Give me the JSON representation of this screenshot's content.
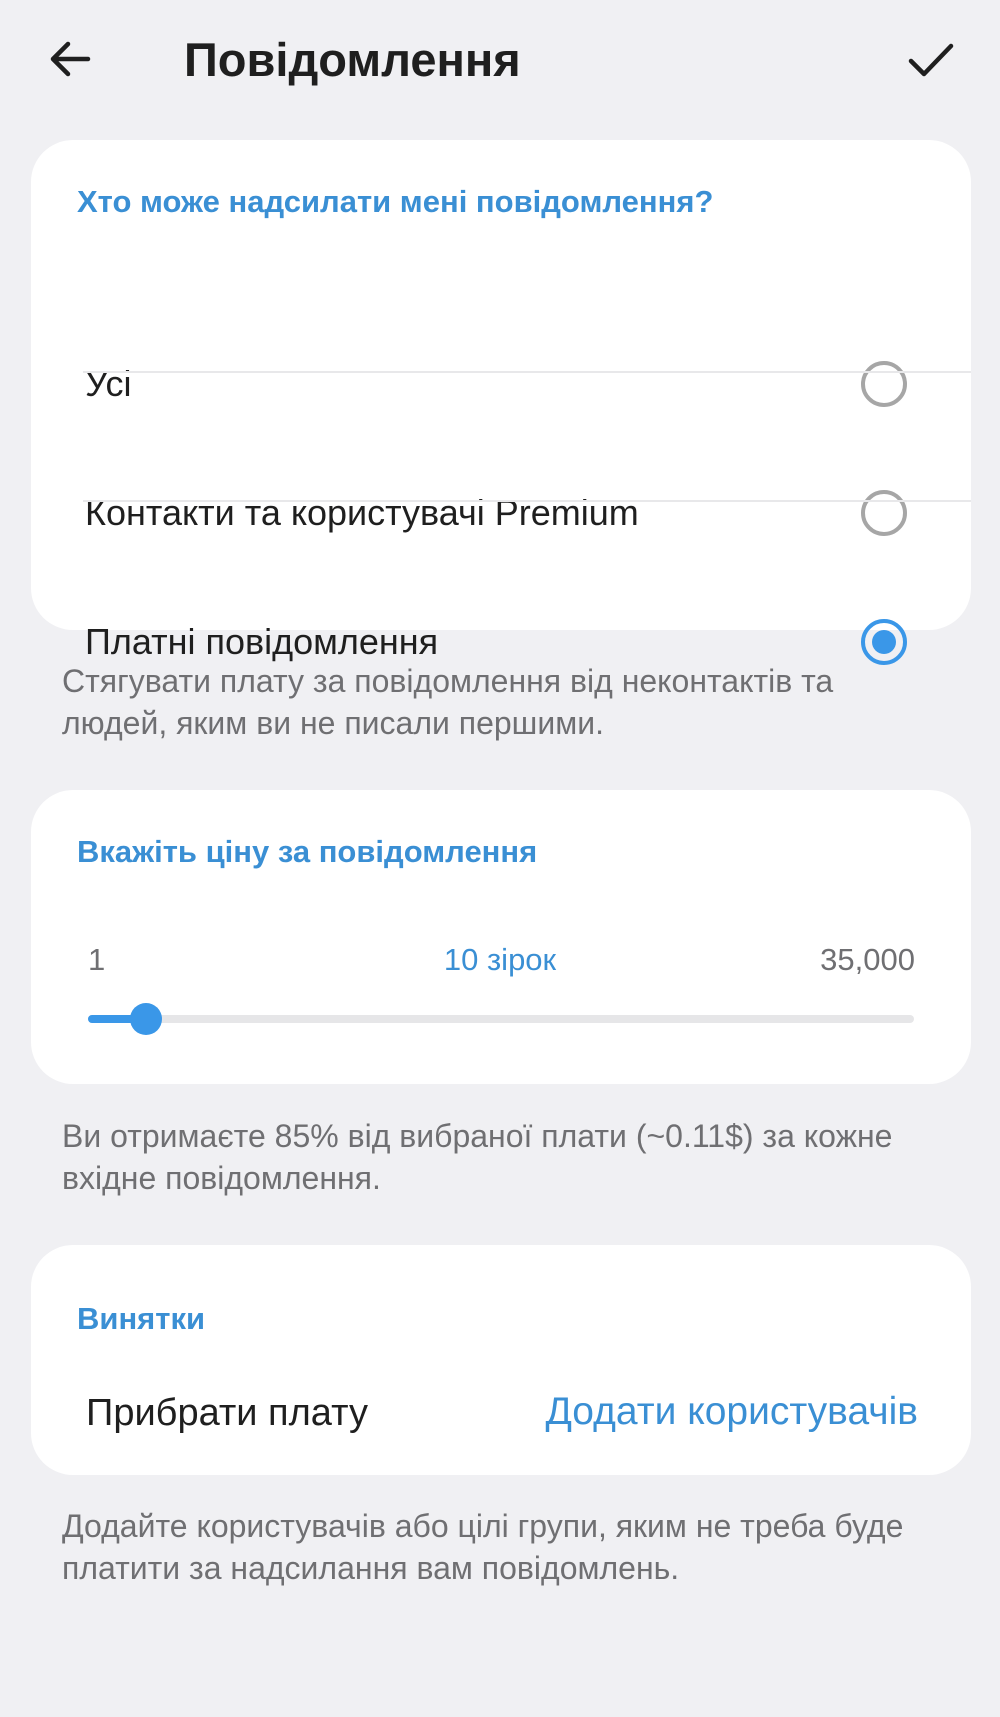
{
  "header": {
    "title": "Повідомлення"
  },
  "who_can_message": {
    "title": "Хто може надсилати мені повідомлення?",
    "options": [
      {
        "label": "Усі",
        "selected": false
      },
      {
        "label": "Контакти та користувачі Premium",
        "selected": false
      },
      {
        "label": "Платні повідомлення",
        "selected": true
      }
    ],
    "footnote": "Стягувати плату за повідомлення від неконтактів та людей, яким ви не писали першими."
  },
  "price": {
    "title": "Вкажіть ціну за повідомлення",
    "min_label": "1",
    "max_label": "35,000",
    "value_label": "10 зірок",
    "slider_fraction": 0.07,
    "footnote": "Ви отримаєте 85% від вибраної плати (~0.11$) за кожне вхідне повідомлення."
  },
  "exceptions": {
    "title": "Винятки",
    "row_label": "Прибрати плату",
    "action_label": "Додати користувачів",
    "footnote": "Додайте користувачів або цілі групи, яким не треба буде платити за надсилання вам повідомлень."
  },
  "colors": {
    "accent": "#3a97e8",
    "section_title": "#3a8fd4",
    "background": "#f0f0f3",
    "card": "#ffffff"
  },
  "icons": {
    "back": "arrow-left-icon",
    "confirm": "checkmark-icon"
  }
}
